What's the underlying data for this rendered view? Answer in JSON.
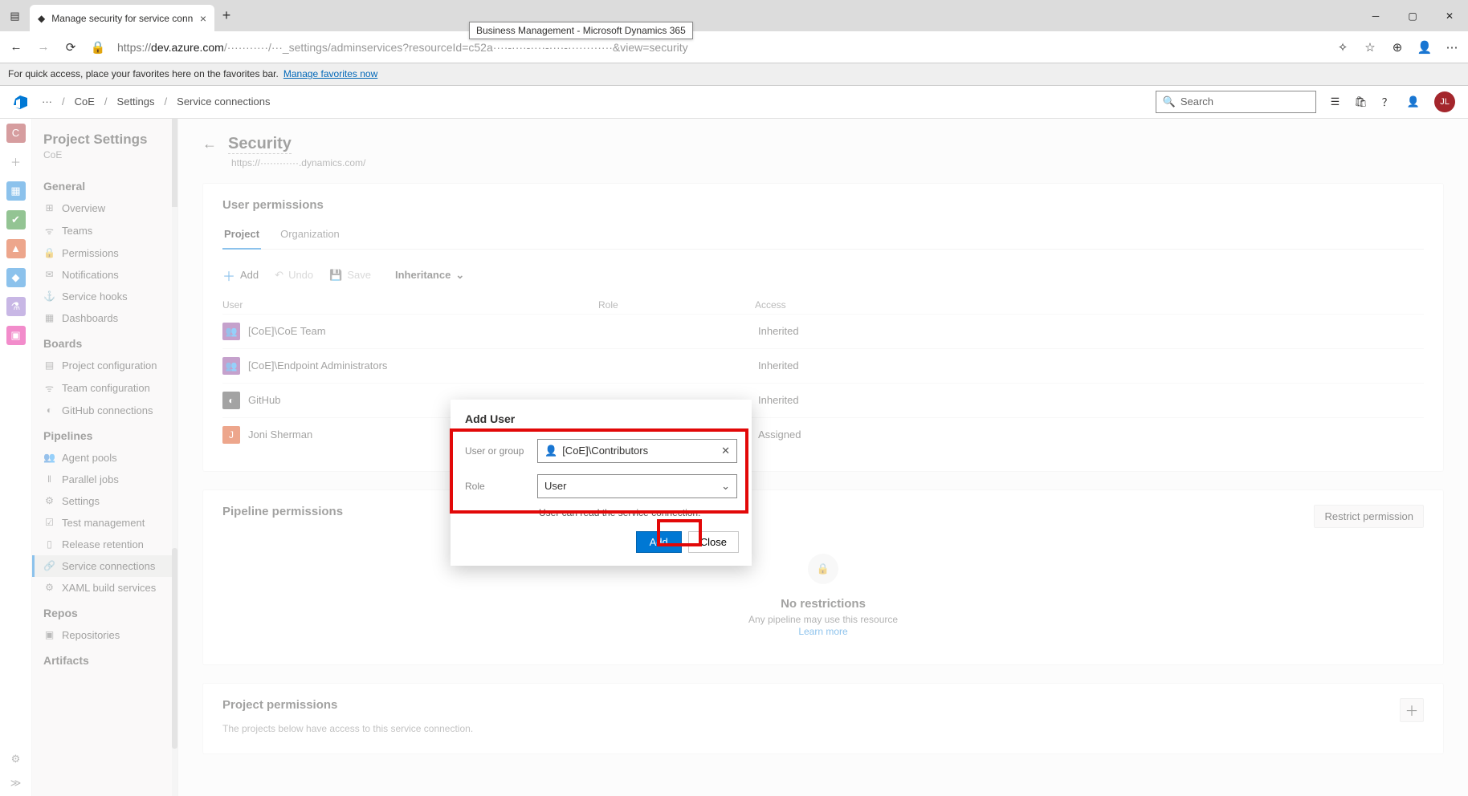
{
  "browser": {
    "tab_title": "Manage security for service conn",
    "tooltip": "Business Management - Microsoft Dynamics 365",
    "url_prefix": "https://",
    "url_host": "dev.azure.com",
    "url_path": "/···········/···_settings/adminservices?resourceId=c52a····-····-····-····-············&view=security",
    "fav_hint": "For quick access, place your favorites here on the favorites bar.",
    "fav_link": "Manage favorites now"
  },
  "header": {
    "crumb1": "···",
    "crumb2": "CoE",
    "crumb3": "Settings",
    "crumb4": "Service connections",
    "search_ph": "Search",
    "avatar": "JL"
  },
  "leftbar": {
    "items": [
      "C",
      "+",
      "📊",
      "✅",
      "🧩",
      "🔷",
      "🧪",
      "📦"
    ]
  },
  "side": {
    "title": "Project Settings",
    "sub": "CoE",
    "sections": {
      "general": {
        "label": "General",
        "items": [
          {
            "icon": "⊞",
            "label": "Overview"
          },
          {
            "icon": "👥",
            "label": "Teams"
          },
          {
            "icon": "🔒",
            "label": "Permissions"
          },
          {
            "icon": "✉",
            "label": "Notifications"
          },
          {
            "icon": "⚓",
            "label": "Service hooks"
          },
          {
            "icon": "▦",
            "label": "Dashboards"
          }
        ]
      },
      "boards": {
        "label": "Boards",
        "items": [
          {
            "icon": "▤",
            "label": "Project configuration"
          },
          {
            "icon": "👥",
            "label": "Team configuration"
          },
          {
            "icon": "◐",
            "label": "GitHub connections"
          }
        ]
      },
      "pipelines": {
        "label": "Pipelines",
        "items": [
          {
            "icon": "⚙",
            "label": "Agent pools"
          },
          {
            "icon": "‖",
            "label": "Parallel jobs"
          },
          {
            "icon": "⚙",
            "label": "Settings"
          },
          {
            "icon": "☑",
            "label": "Test management"
          },
          {
            "icon": "📱",
            "label": "Release retention"
          },
          {
            "icon": "🔗",
            "label": "Service connections",
            "selected": true
          },
          {
            "icon": "⚙",
            "label": "XAML build services"
          }
        ]
      },
      "repos": {
        "label": "Repos",
        "items": [
          {
            "icon": "▣",
            "label": "Repositories"
          }
        ]
      },
      "artifacts": {
        "label": "Artifacts",
        "items": []
      }
    }
  },
  "page": {
    "title": "Security",
    "url": "https://············.dynamics.com/",
    "sections": {
      "user_perm": {
        "heading": "User permissions",
        "tabs": [
          "Project",
          "Organization"
        ],
        "toolbar": {
          "add": "Add",
          "undo": "Undo",
          "save": "Save",
          "inherit": "Inheritance"
        },
        "cols": {
          "user": "User",
          "role": "Role",
          "access": "Access"
        },
        "rows": [
          {
            "icon_bg": "#7e2f8e",
            "name": "[CoE]\\CoE Team",
            "role": "",
            "access": "Inherited"
          },
          {
            "icon_bg": "#7e2f8e",
            "name": "[CoE]\\Endpoint Administrators",
            "role": "",
            "access": "Inherited"
          },
          {
            "icon_bg": "#333333",
            "name": "GitHub",
            "role": "",
            "access": "Inherited"
          },
          {
            "icon_bg": "#d83b01",
            "name": "Joni Sherman",
            "role": "",
            "access": "Assigned"
          }
        ]
      },
      "pipe_perm": {
        "heading": "Pipeline permissions",
        "restrict_btn": "Restrict permission",
        "nr_title": "No restrictions",
        "nr_sub": "Any pipeline may use this resource",
        "nr_link": "Learn more"
      },
      "proj_perm": {
        "heading": "Project permissions",
        "sub": "The projects below have access to this service connection."
      }
    }
  },
  "dialog": {
    "title": "Add User",
    "user_label": "User or group",
    "user_value": "[CoE]\\Contributors",
    "role_label": "Role",
    "role_value": "User",
    "help": "User can read the service connection.",
    "add": "Add",
    "close": "Close"
  }
}
